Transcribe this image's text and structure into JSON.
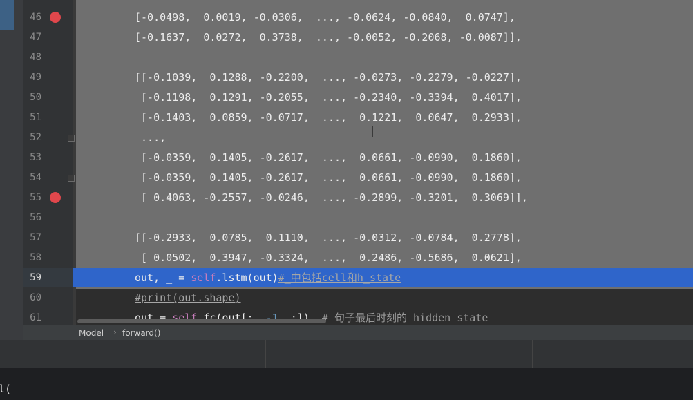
{
  "lines": [
    {
      "no": "46",
      "text": "[-0.0498,  0.0019, -0.0306,  ..., -0.0624, -0.0840,  0.0747],",
      "breakpoint": true
    },
    {
      "no": "47",
      "text": "[-0.1637,  0.0272,  0.3738,  ..., -0.0052, -0.2068, -0.0087]],"
    },
    {
      "no": "48",
      "text": ""
    },
    {
      "no": "49",
      "text": "[[-0.1039,  0.1288, -0.2200,  ..., -0.0273, -0.2279, -0.0227],"
    },
    {
      "no": "50",
      "text": " [-0.1198,  0.1291, -0.2055,  ..., -0.2340, -0.3394,  0.4017],"
    },
    {
      "no": "51",
      "text": " [-0.1403,  0.0859, -0.0717,  ...,  0.1221,  0.0647,  0.2933],"
    },
    {
      "no": "52",
      "text": " ...,"
    },
    {
      "no": "53",
      "text": " [-0.0359,  0.1405, -0.2617,  ...,  0.0661, -0.0990,  0.1860],"
    },
    {
      "no": "54",
      "text": " [-0.0359,  0.1405, -0.2617,  ...,  0.0661, -0.0990,  0.1860],"
    },
    {
      "no": "55",
      "text": " [ 0.4063, -0.2557, -0.0246,  ..., -0.2899, -0.3201,  0.3069]],",
      "breakpoint": true
    },
    {
      "no": "56",
      "text": ""
    },
    {
      "no": "57",
      "text": "[[-0.2933,  0.0785,  0.1110,  ..., -0.0312, -0.0784,  0.2778],"
    },
    {
      "no": "58",
      "text": " [ 0.0502,  0.3947, -0.3324,  ...,  0.2486, -0.5686,  0.0621],"
    }
  ],
  "active_line": {
    "no": "59",
    "pre": "out, _ = ",
    "self": "self",
    "mid": ".lstm(out)",
    "comment": "#_中包括cell和h_state"
  },
  "line60": {
    "no": "60",
    "text": "#print(out.shape)"
  },
  "line61": {
    "no": "61",
    "pre": "out = ",
    "self": "self",
    "mid": ".fc(out[:, ",
    "num": "-1",
    "post": ", :])  ",
    "comment": "# 句子最后时刻的 hidden state"
  },
  "breadcrumb": {
    "class_name": "Model",
    "sep": "›",
    "method": "forward()"
  },
  "console": {
    "text": "l("
  },
  "colors": {
    "selection": "#2f65ca",
    "breakpoint": "#e0474c",
    "editor_bg": "#6f6f6f"
  }
}
